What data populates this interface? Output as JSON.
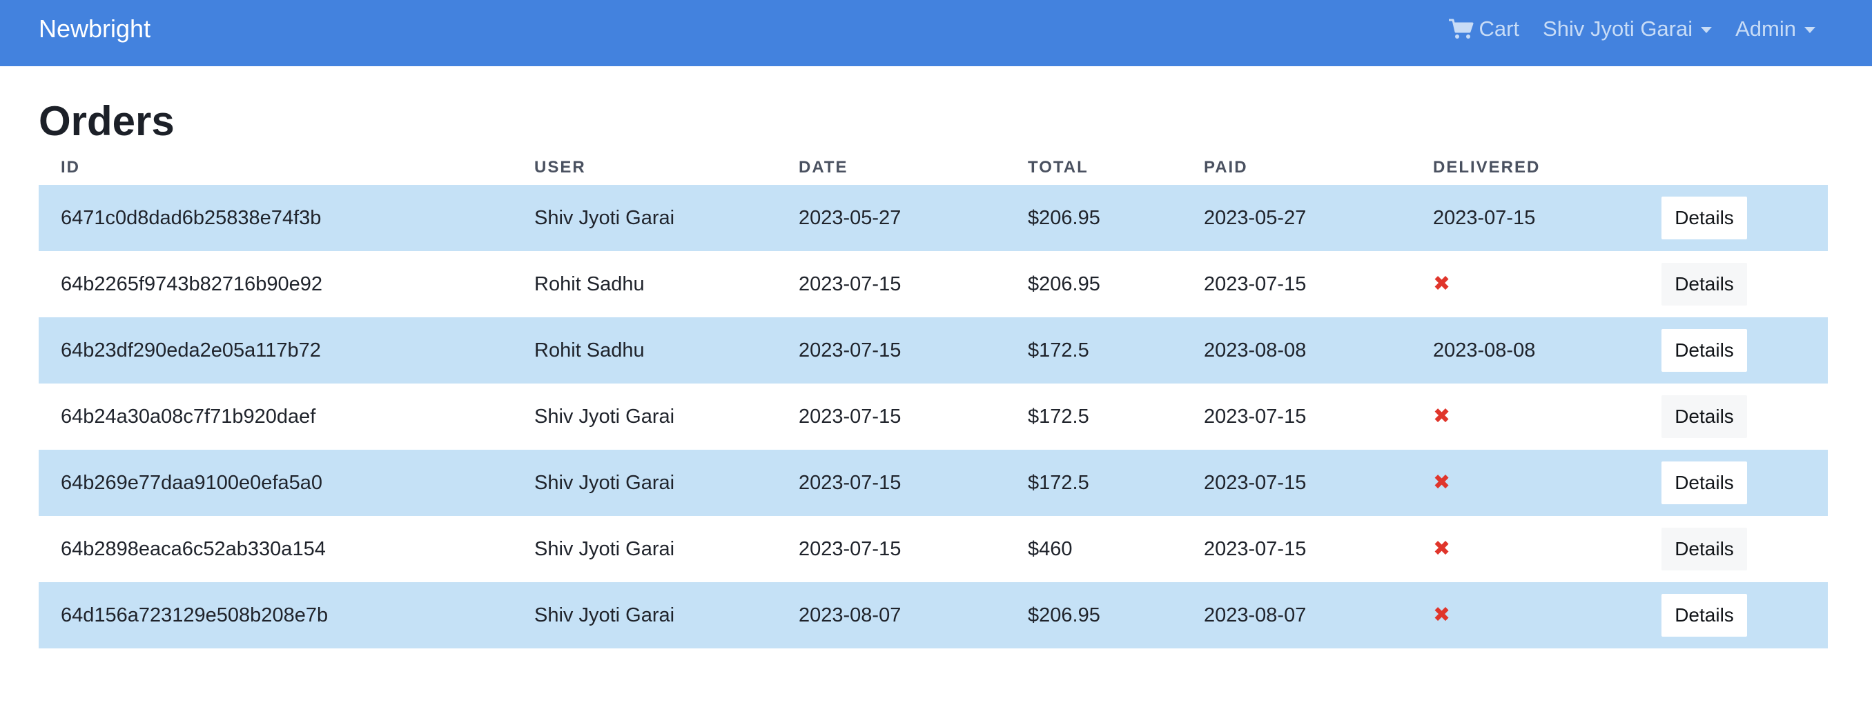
{
  "navbar": {
    "brand": "Newbright",
    "cart_label": "Cart",
    "user_label": "Shiv Jyoti Garai",
    "admin_label": "Admin",
    "background_color": "#4382de"
  },
  "page": {
    "title": "Orders"
  },
  "table": {
    "headers": [
      "ID",
      "USER",
      "DATE",
      "TOTAL",
      "PAID",
      "DELIVERED",
      ""
    ],
    "action_label": "Details",
    "not_delivered_icon": "x-icon",
    "rows": [
      {
        "id": "6471c0d8dad6b25838e74f3b",
        "user": "Shiv Jyoti Garai",
        "date": "2023-05-27",
        "total": "$206.95",
        "paid": "2023-05-27",
        "delivered": "2023-07-15"
      },
      {
        "id": "64b2265f9743b82716b90e92",
        "user": "Rohit Sadhu",
        "date": "2023-07-15",
        "total": "$206.95",
        "paid": "2023-07-15",
        "delivered": null
      },
      {
        "id": "64b23df290eda2e05a117b72",
        "user": "Rohit Sadhu",
        "date": "2023-07-15",
        "total": "$172.5",
        "paid": "2023-08-08",
        "delivered": "2023-08-08"
      },
      {
        "id": "64b24a30a08c7f71b920daef",
        "user": "Shiv Jyoti Garai",
        "date": "2023-07-15",
        "total": "$172.5",
        "paid": "2023-07-15",
        "delivered": null
      },
      {
        "id": "64b269e77daa9100e0efa5a0",
        "user": "Shiv Jyoti Garai",
        "date": "2023-07-15",
        "total": "$172.5",
        "paid": "2023-07-15",
        "delivered": null
      },
      {
        "id": "64b2898eaca6c52ab330a154",
        "user": "Shiv Jyoti Garai",
        "date": "2023-07-15",
        "total": "$460",
        "paid": "2023-07-15",
        "delivered": null
      },
      {
        "id": "64d156a723129e508b208e7b",
        "user": "Shiv Jyoti Garai",
        "date": "2023-08-07",
        "total": "$206.95",
        "paid": "2023-08-07",
        "delivered": null
      }
    ]
  }
}
